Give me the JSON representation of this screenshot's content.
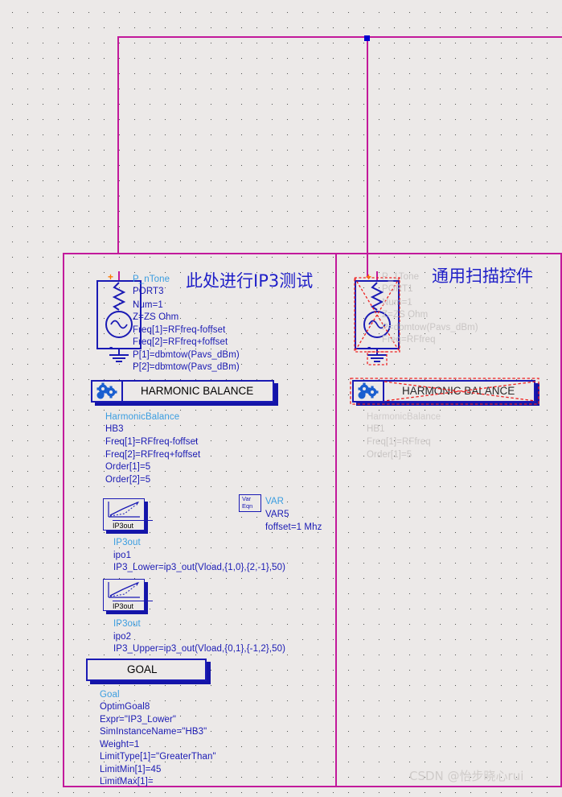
{
  "app": {
    "canvas_name": "schematic-canvas",
    "grid_spacing_px": 19,
    "background_color": "#ece9e8",
    "wire_color": "#c2199b",
    "active_text_color": "#1a1ab4",
    "instance_name_color": "#3a9de0",
    "disabled_text_color": "#c9c5c4",
    "deactivate_mark_color": "#ee2020"
  },
  "annotations": {
    "left_panel_title": "此处进行IP3测试",
    "right_panel_title": "通用扫描控件"
  },
  "watermark": {
    "text": "CSDN @怡步晓心rui"
  },
  "left_panel": {
    "name": "ip3-test-group",
    "port": {
      "symbol_name": "P_nTone",
      "instance": "PORT3",
      "params": [
        "Num=1",
        "Z=ZS Ohm",
        "Freq[1]=RFfreq-foffset",
        "Freq[2]=RFfreq+foffset",
        "P[1]=dbmtow(Pavs_dBm)",
        "P[2]=dbmtow(Pavs_dBm)"
      ],
      "plus_label": "+",
      "minus_label": "-"
    },
    "harmonic_balance": {
      "block_label": "HARMONIC BALANCE",
      "component": "HarmonicBalance",
      "instance": "HB3",
      "params": [
        "Freq[1]=RFfreq-foffset",
        "Freq[2]=RFfreq+foffset",
        "Order[1]=5",
        "Order[2]=5"
      ]
    },
    "ip3_lower": {
      "symbol_caption": "IP3out",
      "component": "IP3out",
      "instance": "ipo1",
      "expression": "IP3_Lower=ip3_out(Vload,{1,0},{2,-1},50)"
    },
    "ip3_upper": {
      "symbol_caption": "IP3out",
      "component": "IP3out",
      "instance": "ipo2",
      "expression": "IP3_Upper=ip3_out(Vload,{0,1},{-1,2},50)"
    },
    "var": {
      "icon_line1": "Var",
      "icon_line2": "Eqn",
      "component": "VAR",
      "instance": "VAR5",
      "equation": "foffset=1 Mhz"
    },
    "goal": {
      "block_label": "GOAL",
      "component": "Goal",
      "instance": "OptimGoal8",
      "params": [
        "Expr=\"IP3_Lower\"",
        "SimInstanceName=\"HB3\"",
        "Weight=1",
        "LimitType[1]=\"GreaterThan\"",
        "LimitMin[1]=45",
        "LimitMax[1]="
      ]
    }
  },
  "right_panel": {
    "name": "general-sweep-group",
    "deactivated": true,
    "port": {
      "symbol_name": "P_1Tone",
      "instance": "PORT1",
      "params": [
        "Num=1",
        "Z=ZS Ohm",
        "P=dbmtow(Pavs_dBm)",
        "Freq=RFfreq"
      ],
      "plus_label": "+",
      "minus_label": "-"
    },
    "harmonic_balance": {
      "block_label": "HARMONIC BALANCE",
      "component": "HarmonicBalance",
      "instance": "HB1",
      "params": [
        "Freq[1]=RFfreq",
        "Order[1]=5"
      ]
    }
  }
}
